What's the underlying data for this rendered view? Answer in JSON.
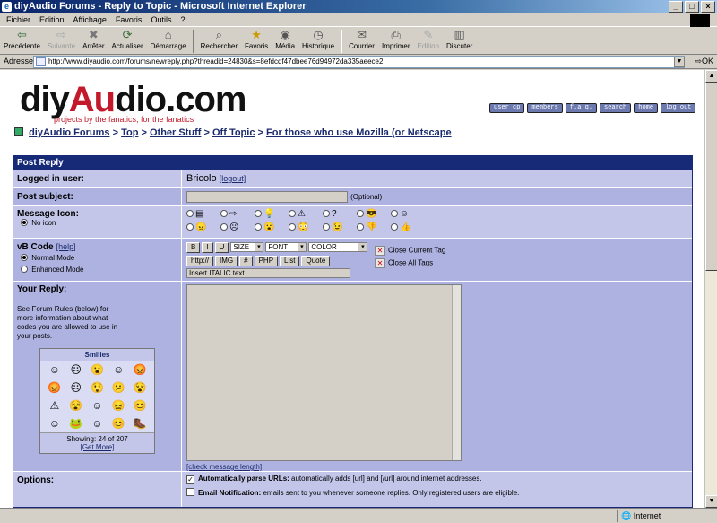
{
  "window": {
    "title": "diyAudio Forums - Reply to Topic - Microsoft Internet Explorer"
  },
  "menu": [
    "Fichier",
    "Edition",
    "Affichage",
    "Favoris",
    "Outils",
    "?"
  ],
  "toolbar": {
    "back": "Précédente",
    "forward": "Suivante",
    "stop": "Arrêter",
    "refresh": "Actualiser",
    "home": "Démarrage",
    "search": "Rechercher",
    "favorites": "Favoris",
    "media": "Média",
    "history": "Historique",
    "mail": "Courrier",
    "print": "Imprimer",
    "edit": "Edition",
    "discuss": "Discuter"
  },
  "address": {
    "label": "Adresse",
    "url": "http://www.diyaudio.com/forums/newreply.php?threadid=24830&s=8efdcdf47dbee76d94972da335aeece2",
    "go": "OK"
  },
  "logo": {
    "main": "diyAudio.com",
    "diy": "diy",
    "au": "Au",
    "dio": "dio.com",
    "tagline": "projects by the fanatics, for the fanatics"
  },
  "nav": [
    "user cp",
    "members",
    "f.a.q.",
    "search",
    "home",
    "log out"
  ],
  "breadcrumb": {
    "root": "diyAudio Forums",
    "sep": ">",
    "items": [
      "Top",
      "Other Stuff",
      "Off Topic",
      "For those who use Mozilla (or Netscape"
    ]
  },
  "form": {
    "header": "Post Reply",
    "logged_label": "Logged in user:",
    "user": "Bricolo",
    "logout": "[logout]",
    "subject_label": "Post subject:",
    "subject_value": "",
    "optional": "(Optional)",
    "icon_label": "Message Icon:",
    "no_icon": "No icon",
    "vb_label": "vB Code",
    "help": "[help]",
    "normal_mode": "Normal Mode",
    "enhanced_mode": "Enhanced Mode",
    "btn_b": "B",
    "btn_i": "I",
    "btn_u": "U",
    "size": "SIZE",
    "font": "FONT",
    "color": "COLOR",
    "btn_http": "http://",
    "btn_img": "IMG",
    "btn_hash": "#",
    "btn_php": "PHP",
    "btn_list": "List",
    "btn_quote": "Quote",
    "close_current": "Close Current Tag",
    "close_all": "Close All Tags",
    "status_text": "Insert ITALIC text",
    "reply_label": "Your Reply:",
    "rules_text": "See Forum Rules (below) for more information about what codes you are allowed to use in your posts.",
    "check_length": "[check message length]",
    "smilies_title": "Smilies",
    "showing": "Showing: 24 of 207",
    "get_more": "[Get More]",
    "options_label": "Options:",
    "opt1_bold": "Automatically parse URLs:",
    "opt1_rest": " automatically adds [url] and [/url] around internet addresses.",
    "opt2_bold": "Email Notification:",
    "opt2_rest": " emails sent to you whenever someone replies. Only registered users are eligible."
  },
  "icons": [
    "icon-document",
    "icon-arrow",
    "icon-lightbulb",
    "icon-exclamation",
    "icon-question",
    "icon-cool",
    "icon-smile",
    "icon-angry",
    "icon-unhappy",
    "icon-talking",
    "icon-redface",
    "icon-wink",
    "icon-thumbsdown",
    "icon-thumbsup"
  ],
  "icon_glyphs": [
    "▤",
    "⇨",
    "💡",
    "⚠",
    "?",
    "😎",
    "☺",
    "😠",
    "☹",
    "😮",
    "😳",
    "😉",
    "👎",
    "👍"
  ],
  "smilies": [
    "☺",
    "☹",
    "😮",
    "☺",
    "😡",
    "😡",
    "☹",
    "😲",
    "😕",
    "😵",
    "⚠",
    "😵",
    "☺",
    "😖",
    "😊",
    "☺",
    "🐸",
    "☺",
    "😊",
    "🥾"
  ],
  "status": {
    "zone": "Internet"
  }
}
